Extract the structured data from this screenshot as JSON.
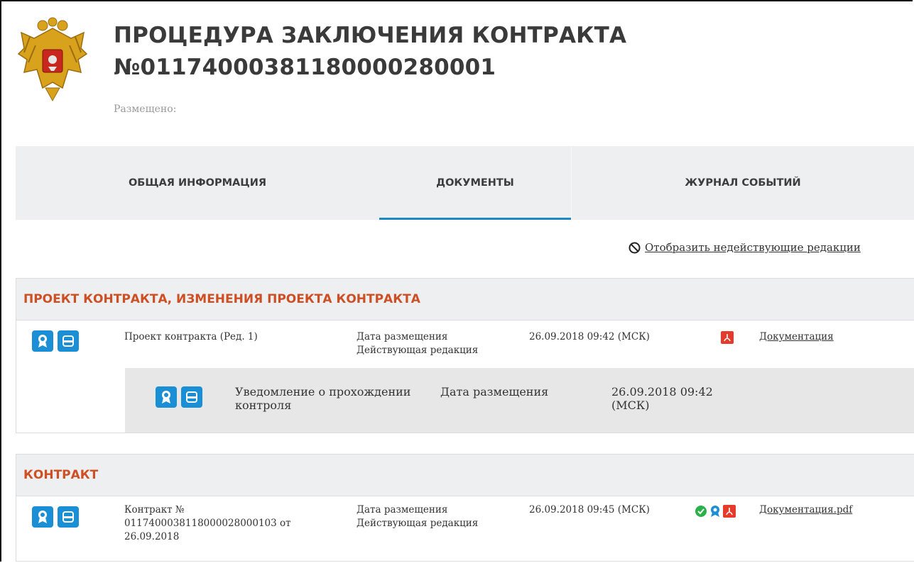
{
  "header": {
    "title_line1": "ПРОЦЕДУРА ЗАКЛЮЧЕНИЯ КОНТРАКТА",
    "title_line2": "№0117400038118000028000​1",
    "posted_label": "Размещено:"
  },
  "tabs": [
    {
      "label": "ОБЩАЯ ИНФОРМАЦИЯ",
      "active": false
    },
    {
      "label": "ДОКУМЕНТЫ",
      "active": true
    },
    {
      "label": "ЖУРНАЛ СОБЫТИЙ",
      "active": false
    }
  ],
  "toggle_link": "Отобразить недействующие редакции",
  "sections": [
    {
      "title": "ПРОЕКТ КОНТРАКТА, ИЗМЕНЕНИЯ ПРОЕКТА КОНТРАКТА",
      "row": {
        "name": "Проект контракта (Ред. 1)",
        "date_label": "Дата размещения",
        "status": "Действующая редакция",
        "date_value": "26.09.2018 09:42 (МСК)",
        "doc_link": "Документация"
      },
      "sub_row": {
        "name_line1": "Уведомление о прохождении",
        "name_line2": "контроля",
        "date_label": "Дата размещения",
        "date_line1": "26.09.2018 09:42",
        "date_line2": "(МСК)"
      }
    },
    {
      "title": "КОНТРАКТ",
      "row": {
        "name_line1": "Контракт №",
        "name_line2": "0117400038118000028000103 от",
        "name_line3": "26.09.2018",
        "date_label": "Дата размещения",
        "status": "Действующая редакция",
        "date_value": "26.09.2018 09:45 (МСК)",
        "doc_link": "Документация.pdf"
      }
    }
  ],
  "colors": {
    "accent_blue": "#1a8fd6",
    "section_title": "#cf4f24",
    "pdf_red": "#e53b2c",
    "check_green": "#2bb14a"
  },
  "icons": [
    "state-emblem",
    "award-icon",
    "print-icon",
    "ban-icon",
    "pdf-icon",
    "check-circle-icon"
  ]
}
